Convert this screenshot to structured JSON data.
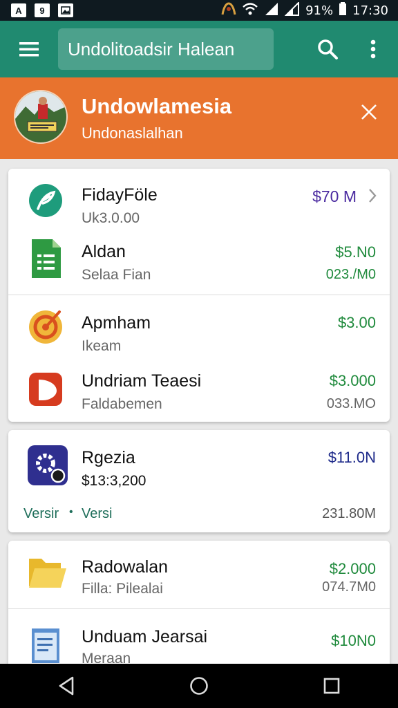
{
  "statusbar": {
    "left_icons": [
      "A",
      "9",
      "img"
    ],
    "battery": "91%",
    "time": "17:30"
  },
  "appbar": {
    "search_text": "Undolitoadsir Halean",
    "icons": [
      "menu-icon",
      "search-icon",
      "more-vert-icon"
    ]
  },
  "banner": {
    "title": "Undowlamesia",
    "subtitle": "Undonaslalhan",
    "color": "#e8732e"
  },
  "cards": [
    {
      "rows": [
        {
          "title": "FidayFöle",
          "subtitle": "Uk3.0.00",
          "price": "$70 M",
          "size": "",
          "price_color": "#4a2aa0",
          "icon": "feather-icon",
          "has_chevron": true
        },
        {
          "title": "Aldan",
          "subtitle": "Selaa Fian",
          "price": "$5.N0",
          "size": "023./M0",
          "price_color": "#1f8a3c",
          "icon": "spreadsheet-icon"
        }
      ]
    },
    {
      "rows": [
        {
          "title": "Apmham",
          "subtitle": "Ikeam",
          "price": "$3.00",
          "size": "",
          "price_color": "#1f8a3c",
          "icon": "target-icon"
        },
        {
          "title": "Undriam Teaesi",
          "subtitle": "Faldabemen",
          "price": "$3.000",
          "size": "033.MO",
          "price_color": "#1f8a3c",
          "icon": "play-icon"
        }
      ]
    },
    {
      "rows": [
        {
          "title": "Rgezia",
          "subtitle": "$13:3,200",
          "price": "$11.0N",
          "size": "",
          "price_color": "#1e2a8a",
          "icon": "settings-icon"
        }
      ],
      "footer": {
        "left_label": "Versir",
        "dot": "•",
        "mid_label": "Versi",
        "size": "231.80M"
      }
    },
    {
      "rows": [
        {
          "title": "Radowalan",
          "subtitle": "Filla: Pilealai",
          "price": "$2.000",
          "size": "074.7M0",
          "price_color": "#1f8a3c",
          "icon": "folder-icon"
        },
        {
          "title": "Unduam Jearsai",
          "subtitle": "Meraan",
          "price": "$10N0",
          "size": "",
          "price_color": "#1f8a3c",
          "icon": "document-icon"
        }
      ]
    }
  ],
  "navbar": {
    "icons": [
      "back-icon",
      "home-icon",
      "recents-icon"
    ]
  }
}
